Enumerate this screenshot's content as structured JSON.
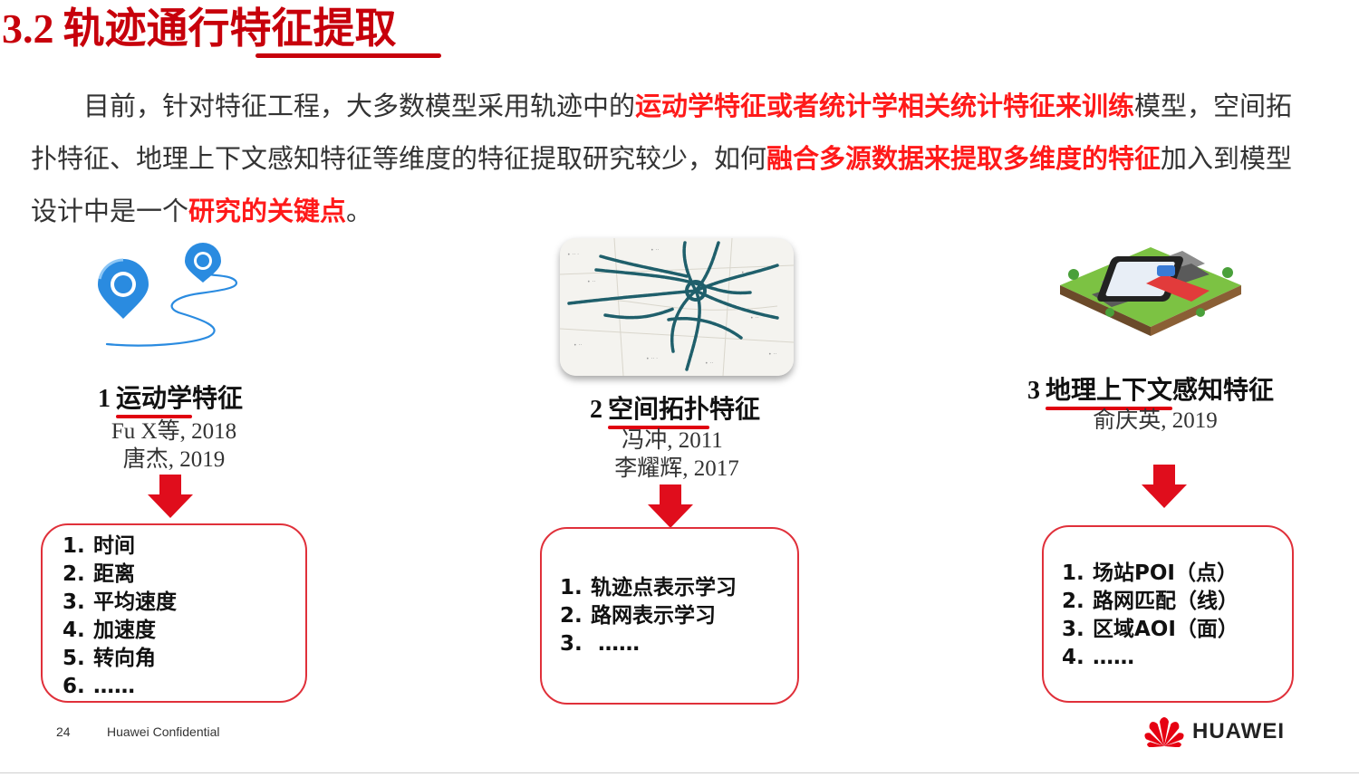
{
  "title": {
    "number": "3.2",
    "text": "轨迹通行特征提取"
  },
  "paragraph": {
    "p1": "目前，针对特征工程，大多数模型采用轨迹中的",
    "h1": "运动学特征或者统计学相关统计特征来训练",
    "p2": "模型，空间拓扑特征、地理上下文感知特征等维度的特征提取研究较少，如何",
    "h2": "融合多源数据来提取多维度的特征",
    "p3": "加入到模型设计中是一个",
    "h3": "研究的关键点",
    "p4": "。"
  },
  "columns": [
    {
      "number": "1",
      "title_underlined": "运动学",
      "title_rest": "特征",
      "refs": [
        "Fu X等, 2018",
        "唐杰, 2019"
      ],
      "items": [
        {
          "n": "1.",
          "t": "时间"
        },
        {
          "n": "2.",
          "t": "距离"
        },
        {
          "n": "3.",
          "t": "平均速度"
        },
        {
          "n": "4.",
          "t": "加速度"
        },
        {
          "n": "5.",
          "t": "转向角"
        },
        {
          "n": "6.",
          "t": "……"
        }
      ]
    },
    {
      "number": "2",
      "title_underlined": "空间拓扑",
      "title_rest": "特征",
      "refs": [
        "冯冲, 2011",
        "李耀辉, 2017"
      ],
      "items": [
        {
          "n": "1.",
          "t": "轨迹点表示学习"
        },
        {
          "n": "2.",
          "t": "路网表示学习"
        },
        {
          "n": "3.",
          "t": " ……"
        }
      ]
    },
    {
      "number": "3",
      "title_underlined": "地理上下文",
      "title_rest": "感知特征",
      "refs": [
        "俞庆英, 2019"
      ],
      "items": [
        {
          "n": "1.",
          "t": "场站POI（点）"
        },
        {
          "n": "2.",
          "t": "路网匹配（线）"
        },
        {
          "n": "3.",
          "t": "区域AOI（面）"
        },
        {
          "n": "4.",
          "t": "……"
        }
      ]
    }
  ],
  "footer": {
    "page": "24",
    "confidential": "Huawei Confidential",
    "brand": "HUAWEI"
  },
  "colors": {
    "accent": "#c7000b",
    "highlight": "#ff1a1a",
    "arrow": "#e00d1c",
    "box_border": "#e0303a",
    "pin": "#2a8be0"
  },
  "icons": [
    "location-pin-icon",
    "trajectory-map-image",
    "map-navigation-icon",
    "down-arrow-icon",
    "huawei-logo"
  ]
}
